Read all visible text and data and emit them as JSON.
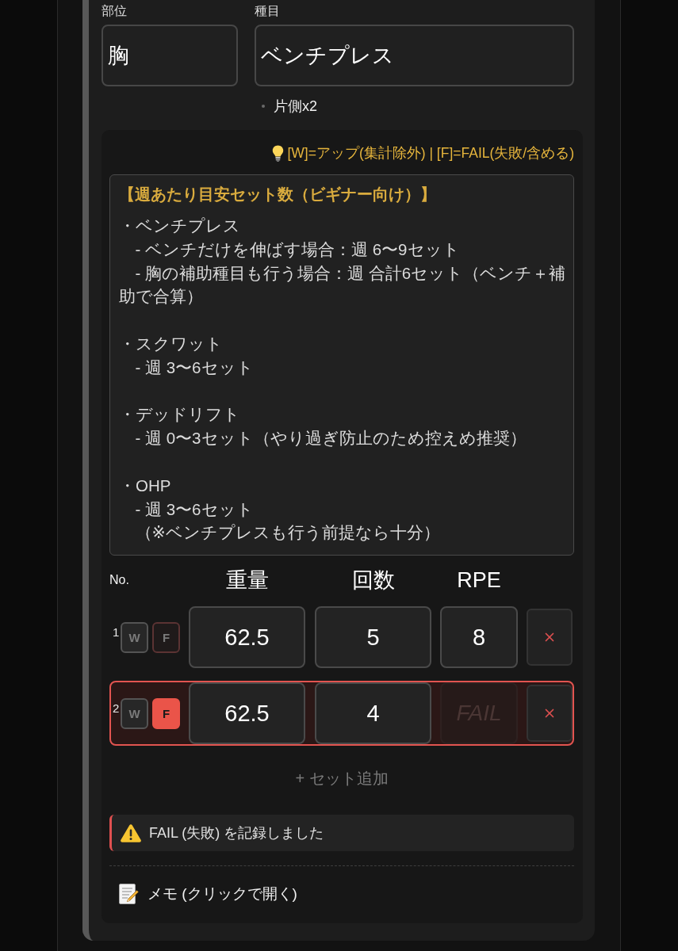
{
  "fields": [
    {
      "label": "部位",
      "value": "胸"
    },
    {
      "label": "種目",
      "value": "ベンチプレス"
    }
  ],
  "note": "片側x2",
  "hint": "[W]=アップ(集計除外) | [F]=FAIL(失敗/含める)",
  "guide": {
    "title": "【週あたり目安セット数（ビギナー向け）】",
    "sections": [
      {
        "heading": "・ベンチプレス",
        "items": [
          "- ベンチだけを伸ばす場合：週 6〜9セット",
          "- 胸の補助種目も行う場合：週 合計6セット（ベンチ＋補助で合算）"
        ]
      },
      {
        "heading": "・スクワット",
        "items": [
          "- 週 3〜6セット"
        ]
      },
      {
        "heading": "・デッドリフト",
        "items": [
          "- 週 0〜3セット（やり過ぎ防止のため控えめ推奨）"
        ]
      },
      {
        "heading": "・OHP",
        "items": [
          "- 週 3〜6セット",
          "（※ベンチプレスも行う前提なら十分）"
        ]
      }
    ]
  },
  "columns": [
    "No.",
    "重量",
    "回数",
    "RPE"
  ],
  "sets": [
    {
      "no": "1",
      "warmup": {
        "label": "W",
        "on": false
      },
      "fail": {
        "label": "F",
        "on": false
      },
      "weight": "62.5",
      "reps": "5",
      "rpe": {
        "value": "8",
        "disabled": false
      }
    },
    {
      "no": "2",
      "warmup": {
        "label": "W",
        "on": false
      },
      "fail": {
        "label": "F",
        "on": true
      },
      "weight": "62.5",
      "reps": "4",
      "rpe": {
        "placeholder": "FAIL",
        "disabled": true
      }
    }
  ],
  "add_button": "+ セット追加",
  "alert": {
    "kind": "warning",
    "text": "FAIL (失敗) を記録しました"
  },
  "memo": {
    "label": "メモ (クリックで開く)"
  }
}
